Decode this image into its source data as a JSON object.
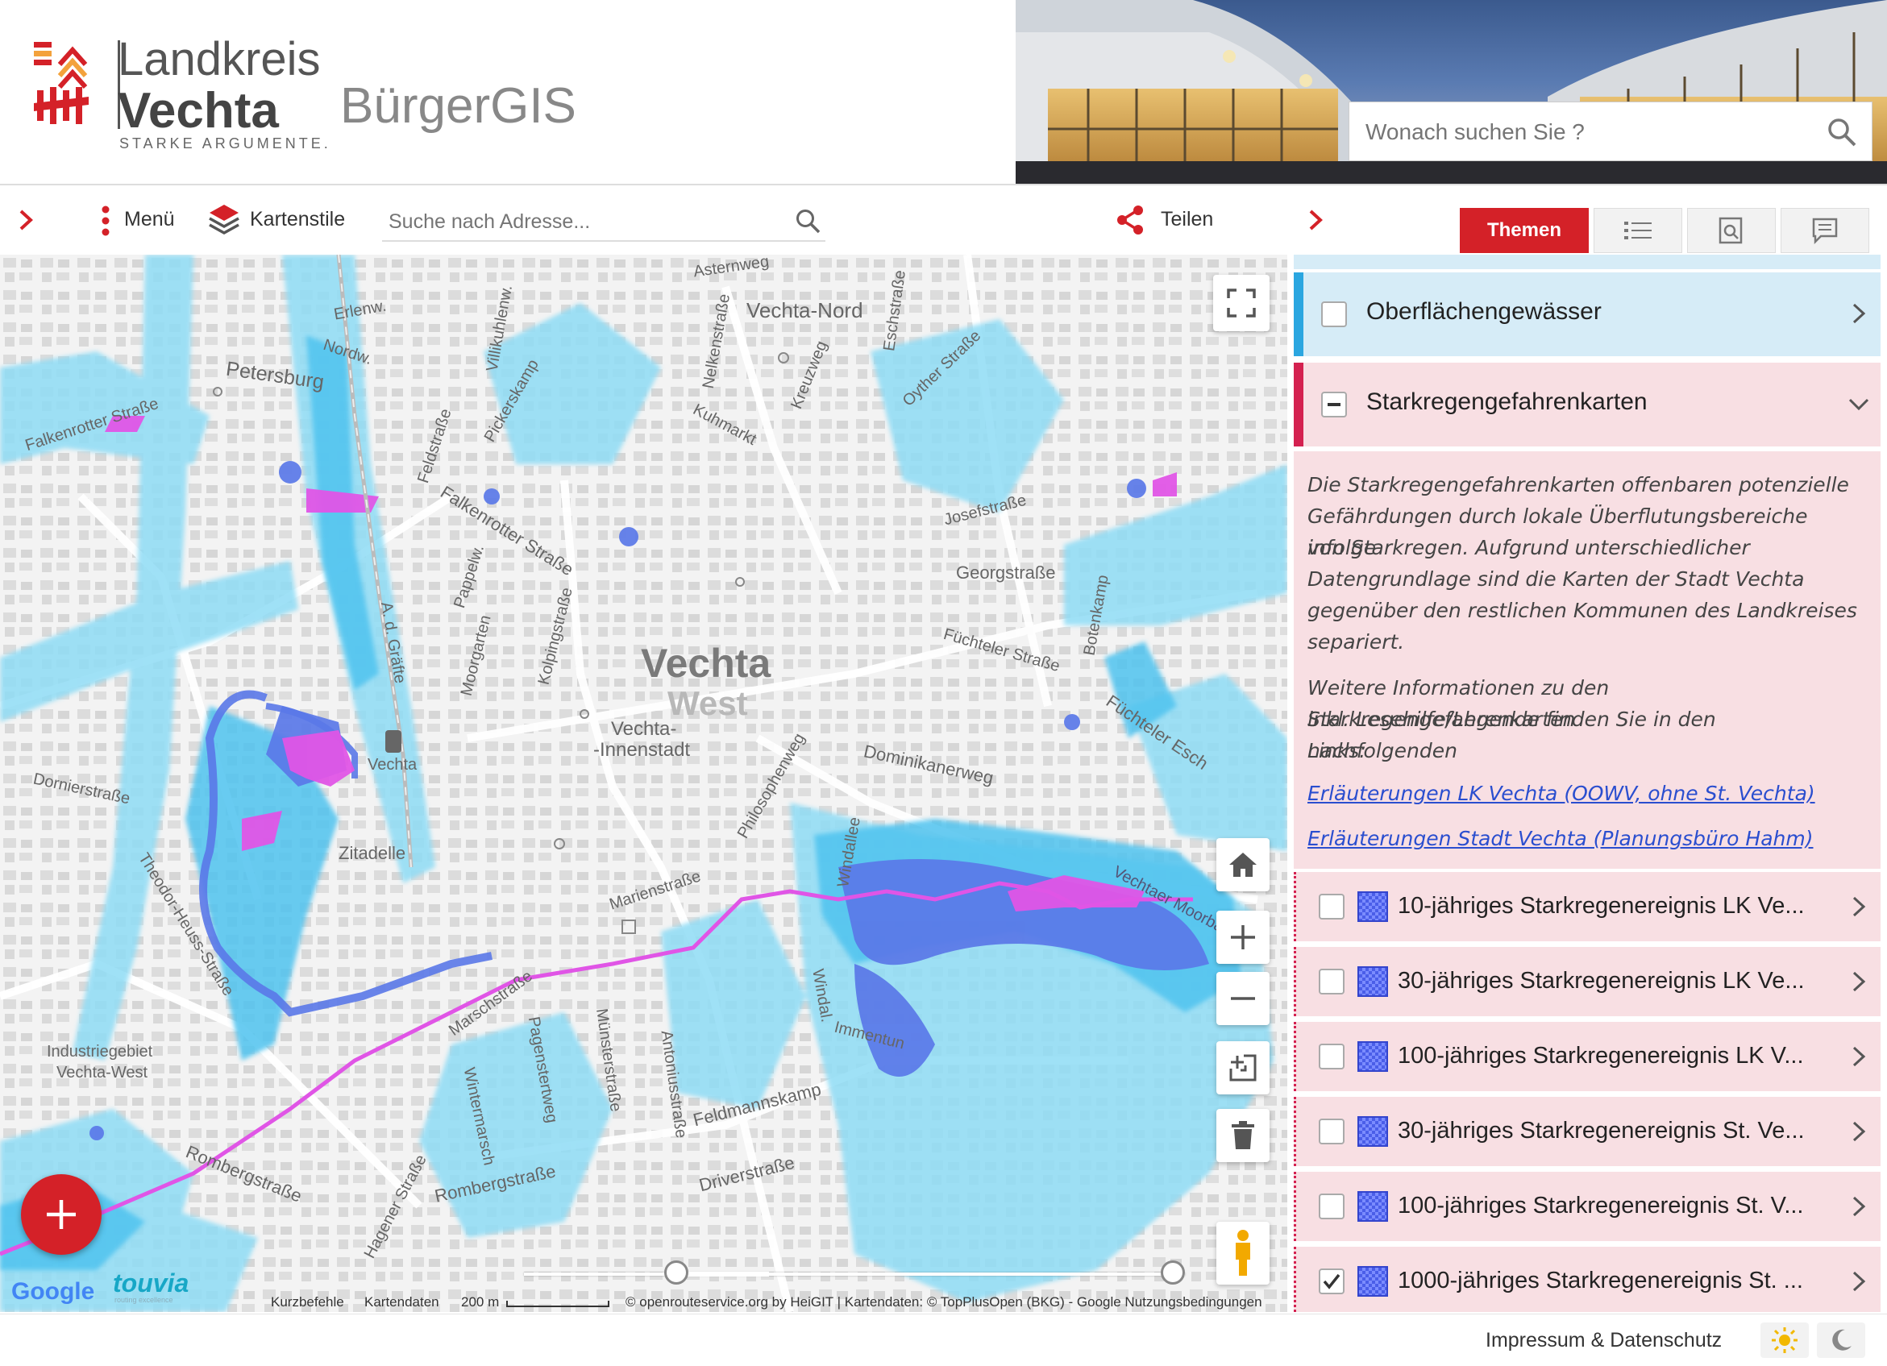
{
  "header": {
    "brand_line1": "Landkreis",
    "brand_line2": "Vechta",
    "brand_tagline": "STARKE ARGUMENTE.",
    "app_title": "BürgerGIS",
    "site_search_placeholder": "Wonach suchen Sie ?",
    "brand_colors": {
      "red": "#d42128",
      "orange": "#f3a23c"
    }
  },
  "toolbar": {
    "menu_label": "Menü",
    "map_styles_label": "Kartenstile",
    "address_placeholder": "Suche nach Adresse...",
    "share_label": "Teilen"
  },
  "panel_tabs": {
    "themes_label": "Themen",
    "accent_color": "#d42128"
  },
  "map": {
    "labels": {
      "vechta_west_big1": "Vechta",
      "vechta_west_big2": "West",
      "vechta_nord": "Vechta-Nord",
      "petersburg": "Petersburg",
      "vechta_innenstadt_1": "Vechta-",
      "vechta_innenstadt_2": "-Innenstadt",
      "zitadelle": "Zitadelle",
      "industrie1": "Industriegebiet",
      "industrie2": "Vechta-West",
      "station": "Vechta",
      "street_falkenrotter": "Falkenrotter Straße",
      "street_falkenrotter2": "Falkenrotter Straße",
      "street_dornier": "Dornierstraße",
      "street_theodor": "Theodor-Heuss-Straße",
      "street_romberg1": "Rombergstraße",
      "street_romberg2": "Rombergstraße",
      "street_marschstrasse": "Marschstraße",
      "street_marienstrasse": "Marienstraße",
      "street_philosophenweg": "Philosophenweg",
      "street_windallee": "Windallee",
      "street_dominikanerweg": "Dominikanerweg",
      "street_feldmannskamp": "Feldmannskamp",
      "street_driverstrasse": "Driverstraße",
      "street_immentun": "Immentun",
      "street_georgstrasse": "Georgstraße",
      "street_fuchteler": "Füchteler Straße",
      "street_fuchteler_esch": "Füchteler Esch",
      "street_kuhmarkt": "Kuhmarkt",
      "street_kolping": "Kolpingstraße",
      "street_moorgarten": "Moorgarten",
      "street_pappelw": "Pappelw.",
      "street_feldstrasse": "Feldstraße",
      "street_pickerskamp": "Pickerskamp",
      "street_asternweg": "Asternweg",
      "street_botenkamp": "Botenkamp",
      "street_josefstrasse": "Josefstraße",
      "street_oyther": "Oyther Straße",
      "street_kreuzweg": "Kreuzweg",
      "street_munsterstrasse": "Münsterstraße",
      "street_antonius": "Antoniusstraße",
      "street_wintermarsch": "Wintermarsch",
      "street_hagener": "Hagener Straße",
      "street_vechtaer_moorbach": "Vechtaer Moorbach",
      "street_ad_grafte": "A. d. Gräfte",
      "street_windal": "Windal.",
      "street_eschstrasse": "Eschstraße",
      "street_erlenw": "Erlenw.",
      "street_nordw": "Nordw.",
      "street_villikuhlenw": "Villikuhlenw.",
      "street_nelkenstrasse": "Nelkenstraße",
      "street_pagenstertweg": "Pagenstertweg"
    },
    "footer_left": {
      "google": "Google",
      "touvia": "touvia",
      "touvia_tag": "routing excellence"
    },
    "attribution": {
      "shortcuts": "Kurzbefehle",
      "map_data": "Kartendaten",
      "scale": "200 m",
      "credits": "© openrouteservice.org by HeiGIT | Kartendaten: © TopPlusOpen (BKG) - Google Nutzungsbedingungen"
    },
    "flood_colors": {
      "light": "#8fdcf5",
      "mid": "#4fc3ef",
      "deep": "#5a78e8",
      "extreme": "#e055e6"
    },
    "time_slider": {
      "handle_a": 0.22,
      "handle_b": 1.0
    }
  },
  "sidebar": {
    "group_surface_water": {
      "label": "Oberflächengewässer",
      "accent": "#2ba6e0",
      "background": "#d6ecf7"
    },
    "group_starkregen": {
      "label": "Starkregengefahrenkarten",
      "accent": "#d42150",
      "background": "#f8dfe3"
    },
    "description_p1_l1": "Die Starkregengefahrenkarten offenbaren potenzielle",
    "description_p1_l2": "Gefährdungen durch lokale Überflutungsbereiche infolge",
    "description_p1_l3": "von Starkregen. Aufgrund unterschiedlicher",
    "description_p1_l4": "Datengrundlage sind die Karten der Stadt Vechta",
    "description_p1_l5": "gegenüber den restlichen Kommunen des Landkreises",
    "description_p1_l6": "separiert.",
    "description_p2_l1": "Weitere Informationen zu den Starkregengefahrenkarten",
    "description_p2_l2": "inkl. Lesehilfe/Legende finden Sie in den nachfolgenden",
    "description_p2_l3": "Links:",
    "link1": "Erläuterungen LK Vechta (OOWV, ohne St. Vechta)",
    "link2": "Erläuterungen Stadt Vechta (Planungsbüro Hahm)",
    "layers": [
      {
        "label": "10-jähriges Starkregenereignis LK Ve...",
        "checked": false
      },
      {
        "label": "30-jähriges Starkregenereignis LK Ve...",
        "checked": false
      },
      {
        "label": "100-jähriges Starkregenereignis LK V...",
        "checked": false
      },
      {
        "label": "30-jähriges Starkregenereignis St. Ve...",
        "checked": false
      },
      {
        "label": "100-jähriges Starkregenereignis St. V...",
        "checked": false
      },
      {
        "label": "1000-jähriges Starkregenereignis St. ...",
        "checked": true
      }
    ]
  },
  "footer": {
    "imprint_label": "Impressum & Datenschutz"
  }
}
